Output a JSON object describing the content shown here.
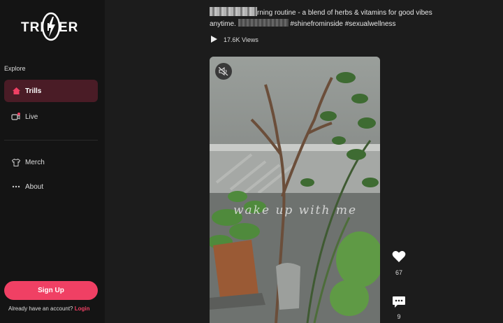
{
  "brand": {
    "logo_left": "TRI",
    "logo_right": "ER",
    "accent": "#f04064"
  },
  "sidebar": {
    "section_title": "Explore",
    "items": [
      {
        "label": "Trills",
        "icon": "home-icon",
        "active": true
      },
      {
        "label": "Live",
        "icon": "live-camera-icon",
        "active": false
      },
      {
        "label": "Merch",
        "icon": "tshirt-icon",
        "active": false
      },
      {
        "label": "About",
        "icon": "dots-icon",
        "active": false
      }
    ],
    "signup_label": "Sign Up",
    "account_prompt": "Already have an account?",
    "login_label": "Login"
  },
  "post": {
    "caption_line1": "rning routine - a blend of herbs & vitamins for good vibes",
    "caption_line2_prefix": "anytime.",
    "caption_line2_rest": "#shinefrominside #sexualwellness",
    "views": "17.6K Views",
    "overlay_text": "wake up with me",
    "likes": "67",
    "comments": "9"
  }
}
